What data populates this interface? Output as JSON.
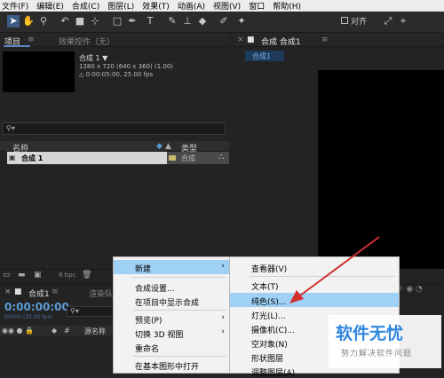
{
  "menubar": {
    "items": [
      "文件(F)",
      "编辑(E)",
      "合成(C)",
      "图层(L)",
      "效果(T)",
      "动画(A)",
      "视图(V)",
      "窗口",
      "帮助(H)"
    ]
  },
  "toolbar": {
    "align_label": "对齐"
  },
  "project_panel": {
    "tab_project": "项目",
    "tab_effects": "效果控件（无）",
    "comp_name": "合成 1 ▼",
    "comp_dims": "1280 x 720 (640 x 360) (1.00)",
    "comp_duration": "△ 0:00:05:00, 25.00 fps",
    "col_name": "名称",
    "col_type": "类型",
    "row_name": "合成 1",
    "row_type": "合成",
    "bpc": "8 bpc"
  },
  "viewer": {
    "tab_title": "合成 合成1",
    "comp_tab": "合成1"
  },
  "timeline": {
    "tab": "合成1",
    "time": "0:00:00:00",
    "fps": "00000 (25.00 fps)",
    "render_queue": "渲染队",
    "source_name": "源名称"
  },
  "context_menu": {
    "items": [
      {
        "label": "新建",
        "arrow": "›"
      },
      {
        "label": "合成设置..."
      },
      {
        "label": "在项目中显示合成"
      },
      {
        "label": "预览(P)",
        "arrow": "›"
      },
      {
        "label": "切换 3D 视图",
        "arrow": "›"
      },
      {
        "label": "重命名"
      },
      {
        "label": "在基本图形中打开"
      }
    ]
  },
  "submenu": {
    "items": [
      {
        "label": "查看器(V)"
      },
      {
        "label": "文本(T)"
      },
      {
        "label": "纯色(S)..."
      },
      {
        "label": "灯光(L)..."
      },
      {
        "label": "摄像机(C)..."
      },
      {
        "label": "空对象(N)"
      },
      {
        "label": "形状图层"
      },
      {
        "label": "调整图层(A)"
      }
    ]
  },
  "watermark": {
    "title": "软件无忧",
    "subtitle": "努力解决软件问题"
  },
  "colors": {
    "accent_blue": "#5b9bd5",
    "highlight": "#9fd0f5",
    "arrow_red": "#d32f2f"
  }
}
